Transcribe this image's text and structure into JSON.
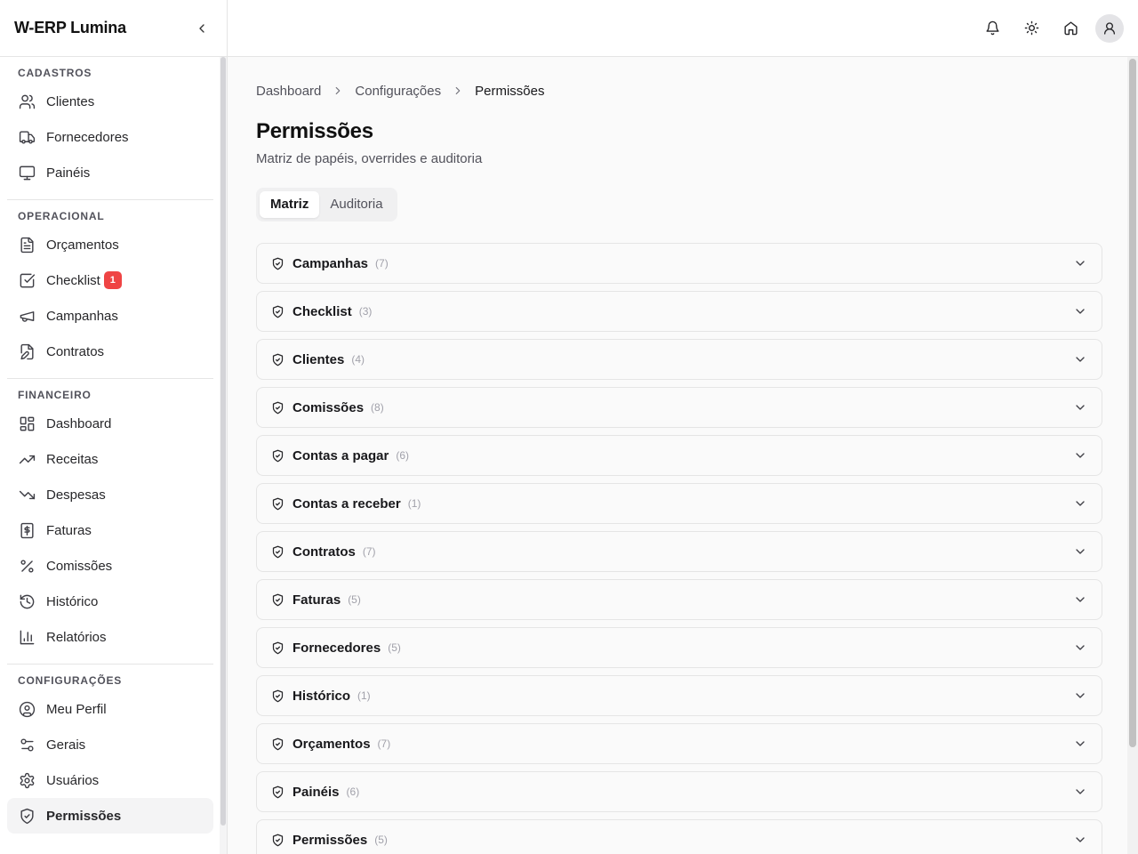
{
  "app": {
    "title": "W-ERP Lumina"
  },
  "sidebar": {
    "sections": [
      {
        "title": "CADASTROS",
        "items": [
          {
            "label": "Clientes",
            "icon": "users-icon"
          },
          {
            "label": "Fornecedores",
            "icon": "truck-icon"
          },
          {
            "label": "Painéis",
            "icon": "monitor-icon"
          }
        ]
      },
      {
        "title": "OPERACIONAL",
        "items": [
          {
            "label": "Orçamentos",
            "icon": "file-text-icon"
          },
          {
            "label": "Checklist",
            "icon": "check-square-icon",
            "badge": "1"
          },
          {
            "label": "Campanhas",
            "icon": "megaphone-icon"
          },
          {
            "label": "Contratos",
            "icon": "file-edit-icon"
          }
        ]
      },
      {
        "title": "FINANCEIRO",
        "items": [
          {
            "label": "Dashboard",
            "icon": "layout-dashboard-icon"
          },
          {
            "label": "Receitas",
            "icon": "trending-up-icon"
          },
          {
            "label": "Despesas",
            "icon": "trending-down-icon"
          },
          {
            "label": "Faturas",
            "icon": "receipt-dollar-icon"
          },
          {
            "label": "Comissões",
            "icon": "percent-icon"
          },
          {
            "label": "Histórico",
            "icon": "history-icon"
          },
          {
            "label": "Relatórios",
            "icon": "bar-chart-icon"
          }
        ]
      },
      {
        "title": "CONFIGURAÇÕES",
        "items": [
          {
            "label": "Meu Perfil",
            "icon": "user-circle-icon"
          },
          {
            "label": "Gerais",
            "icon": "sliders-icon"
          },
          {
            "label": "Usuários",
            "icon": "gear-icon"
          },
          {
            "label": "Permissões",
            "icon": "shield-check-icon",
            "active": true
          }
        ]
      }
    ]
  },
  "topbar": {
    "icons": [
      "bell-icon",
      "sun-icon",
      "home-icon",
      "user-icon"
    ]
  },
  "breadcrumb": {
    "items": [
      "Dashboard",
      "Configurações"
    ],
    "current": "Permissões"
  },
  "page": {
    "title": "Permissões",
    "subtitle": "Matriz de papéis, overrides e auditoria",
    "tabs": [
      {
        "label": "Matriz",
        "active": true
      },
      {
        "label": "Auditoria",
        "active": false
      }
    ]
  },
  "modules": [
    {
      "name": "Campanhas",
      "count": "(7)"
    },
    {
      "name": "Checklist",
      "count": "(3)"
    },
    {
      "name": "Clientes",
      "count": "(4)"
    },
    {
      "name": "Comissões",
      "count": "(8)"
    },
    {
      "name": "Contas a pagar",
      "count": "(6)"
    },
    {
      "name": "Contas a receber",
      "count": "(1)"
    },
    {
      "name": "Contratos",
      "count": "(7)"
    },
    {
      "name": "Faturas",
      "count": "(5)"
    },
    {
      "name": "Fornecedores",
      "count": "(5)"
    },
    {
      "name": "Histórico",
      "count": "(1)"
    },
    {
      "name": "Orçamentos",
      "count": "(7)"
    },
    {
      "name": "Painéis",
      "count": "(6)"
    },
    {
      "name": "Permissões",
      "count": "(5)"
    }
  ],
  "colors": {
    "badge": "#ef4444",
    "border": "#e5e5e5",
    "background": "#fafafa"
  }
}
